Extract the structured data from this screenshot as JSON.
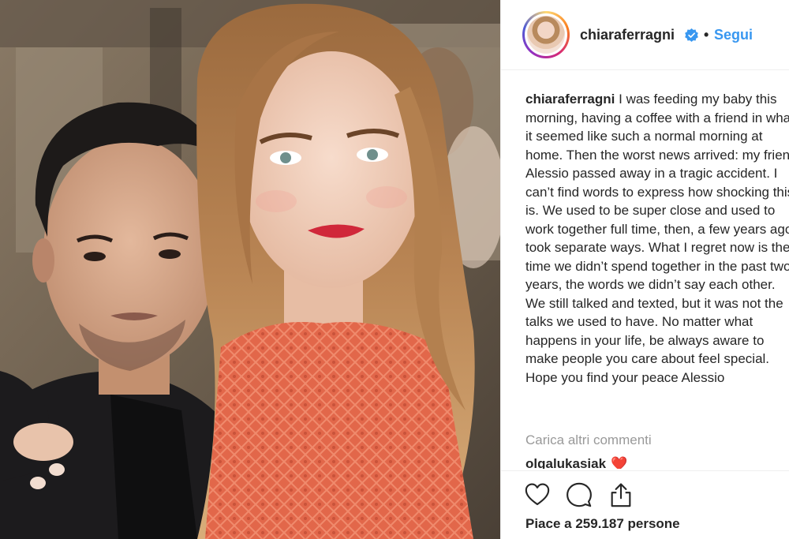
{
  "post": {
    "author": "chiaraferragni",
    "follow_label": "Segui",
    "separator": "•",
    "caption_user": "chiaraferragni",
    "caption_text": "I was feeding my baby this morning, having a coffee with a friend in what it seemed like such a normal morning at home. Then the worst news arrived: my friend Alessio passed away in a tragic accident. I can’t find words to express how shocking this is. We used to be super close and used to work together full time, then, a few years ago, took separate ways. What I regret now is the time we didn’t spend together in the past two years, the words we didn’t say each other. We still talked and texted, but it was not the talks we used to have. No matter what happens in your life, be always aware to make people you care about feel special. Hope you find your peace Alessio",
    "more_comments_label": "Carica altri commenti",
    "comment_preview_user": "olgalukasiak",
    "comment_preview_emoji": "❤️",
    "likes_label": "Piace a 259.187 persone"
  },
  "icons": {
    "verified": "verified-badge-icon",
    "like": "heart-icon",
    "comment": "comment-bubble-icon",
    "share": "share-icon"
  },
  "colors": {
    "link_blue": "#3897f0",
    "text": "#262626",
    "muted": "#999999",
    "heart_red": "#ed4956"
  }
}
